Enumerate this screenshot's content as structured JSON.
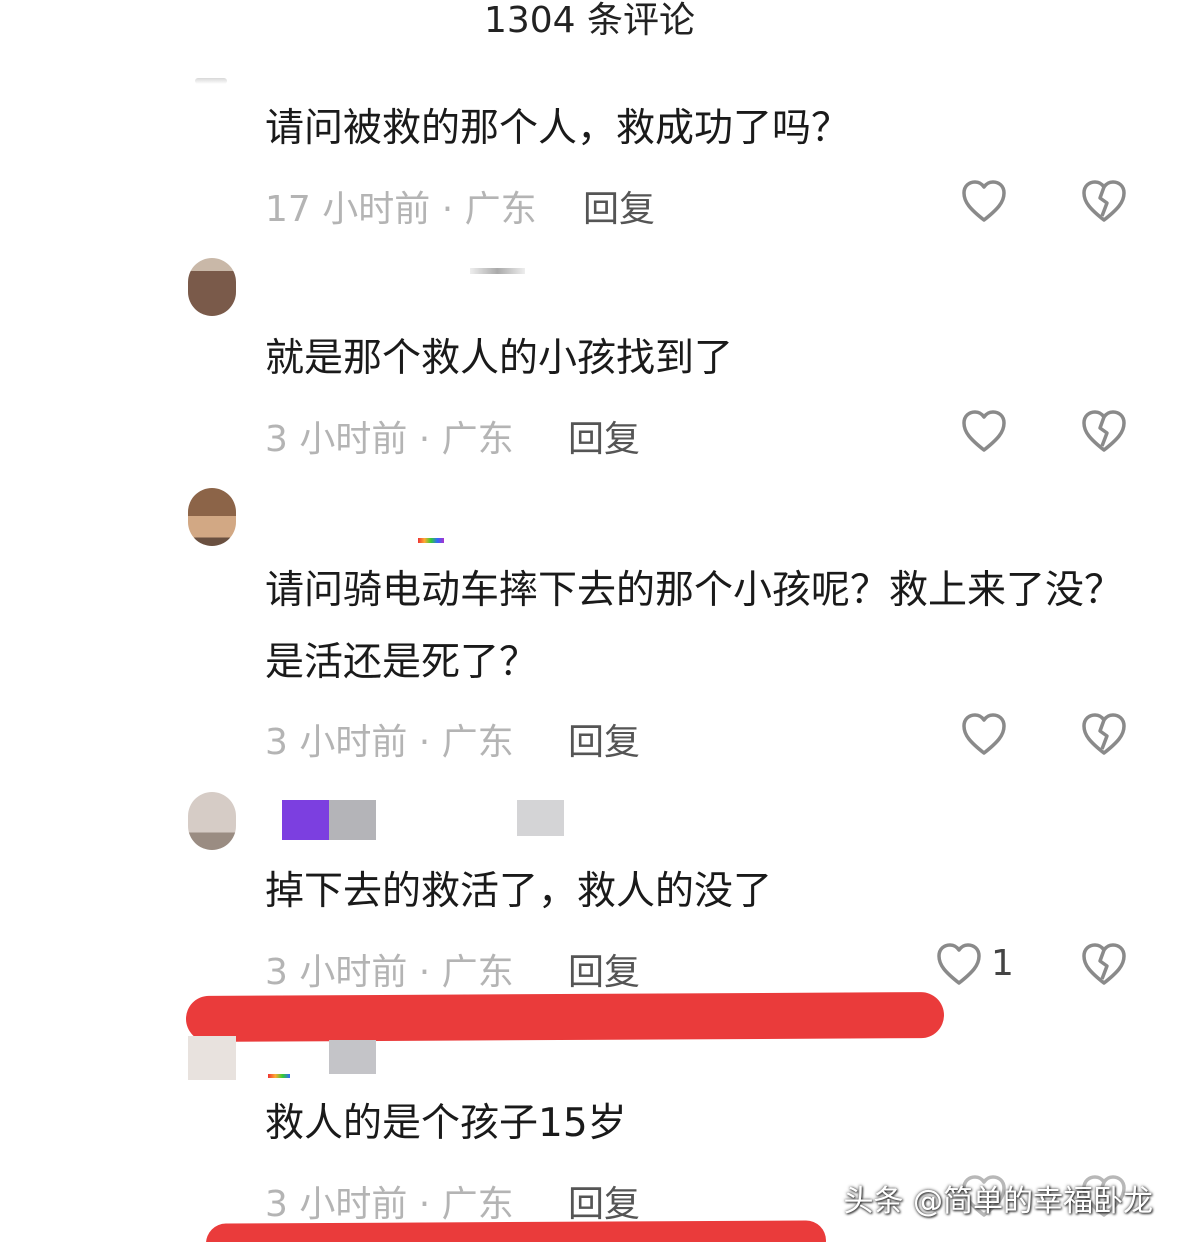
{
  "header": {
    "title": "1304 条评论"
  },
  "comments": [
    {
      "text": "请问被救的那个人，救成功了吗？",
      "time_location": "17 小时前 · 广东",
      "reply_label": "回复",
      "like_count": ""
    },
    {
      "text": "就是那个救人的小孩找到了",
      "time_location": "3 小时前 · 广东",
      "reply_label": "回复",
      "like_count": ""
    },
    {
      "text": "请问骑电动车摔下去的那个小孩呢？救上来了没？是活还是死了？",
      "time_location": "3 小时前 · 广东",
      "reply_label": "回复",
      "like_count": ""
    },
    {
      "text": "掉下去的救活了，救人的没了",
      "time_location": "3 小时前 · 广东",
      "reply_label": "回复",
      "like_count": "1"
    },
    {
      "text": "救人的是个孩子15岁",
      "time_location": "3 小时前 · 广东",
      "reply_label": "回复",
      "like_count": ""
    }
  ],
  "watermark": {
    "text": "头条 @简单的幸福卧龙"
  },
  "colors": {
    "highlight_red": "#ea3b3b",
    "meta_gray": "#b4b4b4",
    "icon_gray": "#8a8a8a"
  }
}
